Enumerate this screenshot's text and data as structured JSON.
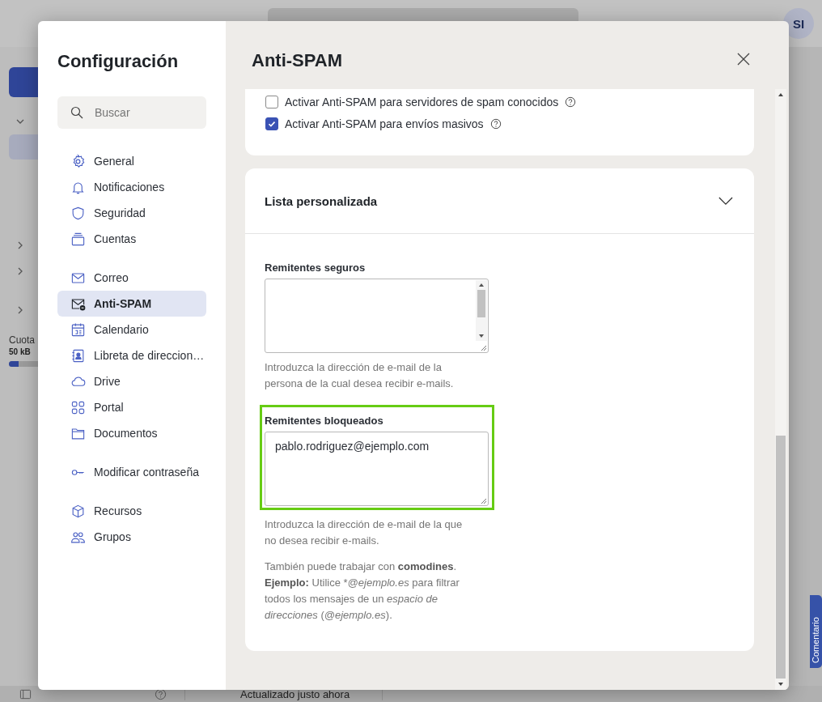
{
  "app": {
    "avatar": "SI",
    "quota_label": "Cuota",
    "quota_value": "50 kB",
    "quota": {
      "level": 0.1
    },
    "status": "Actualizado justo ahora",
    "feedback": "Comentario"
  },
  "dialog": {
    "title": "Configuración",
    "search": {
      "placeholder": "Buscar"
    },
    "nav": [
      [
        {
          "kind": "gear",
          "label": "General",
          "selected": false
        },
        {
          "kind": "bell",
          "label": "Notificaciones",
          "selected": false
        },
        {
          "kind": "shield",
          "label": "Seguridad",
          "selected": false
        },
        {
          "kind": "stack",
          "label": "Cuentas",
          "selected": false
        }
      ],
      [
        {
          "kind": "mail",
          "label": "Correo",
          "selected": false
        },
        {
          "kind": "mailblock",
          "label": "Anti-SPAM",
          "selected": true
        },
        {
          "kind": "calendar",
          "label": "Calendario",
          "selected": false
        },
        {
          "kind": "contact",
          "label": "Libreta de direccion…",
          "selected": false
        },
        {
          "kind": "cloud",
          "label": "Drive",
          "selected": false
        },
        {
          "kind": "grid",
          "label": "Portal",
          "selected": false
        },
        {
          "kind": "folder",
          "label": "Documentos",
          "selected": false
        }
      ],
      [
        {
          "kind": "key",
          "label": "Modificar contraseña",
          "selected": false
        }
      ],
      [
        {
          "kind": "cube",
          "label": "Recursos",
          "selected": false
        },
        {
          "kind": "people",
          "label": "Grupos",
          "selected": false
        }
      ]
    ]
  },
  "panel": {
    "title": "Anti-SPAM",
    "options": [
      {
        "label": "Activar Anti-SPAM para servidores de spam conocidos",
        "checked": false
      },
      {
        "label": "Activar Anti-SPAM para envíos masivos",
        "checked": true
      }
    ],
    "section": {
      "title": "Lista personalizada",
      "expanded": true,
      "fields": [
        {
          "label": "Remitentes seguros",
          "hint": "Introduzca la dirección de e-mail de la persona de la cual desea recibir e-mails.",
          "highlighted": false
        },
        {
          "label": "Remitentes bloqueados",
          "value": "pablo.rodriguez@ejemplo.com",
          "hint": "Introduzca la dirección de e-mail de la que no desea recibir e-mails.",
          "highlighted": true
        }
      ],
      "note": [
        "También puede trabajar con **comodines**. **Ejemplo:** Utilice *",
        "*@ejemplo.es* para filtrar todos los mensajes de un *espacio de direcciones* (*@ejemplo.es*)."
      ]
    }
  }
}
